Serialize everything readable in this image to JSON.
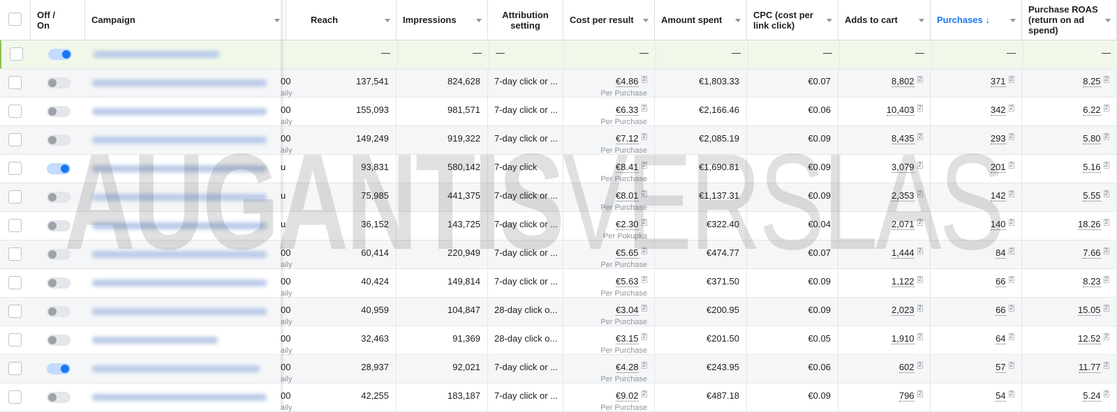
{
  "columns": {
    "off_on": "Off / On",
    "campaign": "Campaign",
    "reach": "Reach",
    "impressions": "Impressions",
    "attribution": "Attribution setting",
    "cost_per_result": "Cost per result",
    "amount_spent": "Amount spent",
    "cpc": "CPC (cost per link click)",
    "adds_to_cart": "Adds to cart",
    "purchases": "Purchases ↓",
    "roas": "Purchase ROAS (return on ad spend)"
  },
  "total_row": {
    "reach": "—",
    "impressions": "—",
    "attribution": "—",
    "cost_per_result": "—",
    "amount_spent": "—",
    "cpc": "—",
    "adds_to_cart": "—",
    "purchases": "—",
    "roas": "—"
  },
  "rows": [
    {
      "on": false,
      "budget": "00",
      "budget_sub": "aily",
      "reach": "137,541",
      "impressions": "824,628",
      "attribution": "7-day click or ...",
      "cost_per_result": "€4.86",
      "result_label": "Per Purchase",
      "amount_spent": "€1,803.33",
      "cpc": "€0.07",
      "adds_to_cart": "8,802",
      "purchases": "371",
      "roas": "8.25"
    },
    {
      "on": false,
      "budget": "00",
      "budget_sub": "aily",
      "reach": "155,093",
      "impressions": "981,571",
      "attribution": "7-day click or ...",
      "cost_per_result": "€6.33",
      "result_label": "Per Purchase",
      "amount_spent": "€2,166.46",
      "cpc": "€0.06",
      "adds_to_cart": "10,403",
      "purchases": "342",
      "roas": "6.22"
    },
    {
      "on": false,
      "budget": "00",
      "budget_sub": "aily",
      "reach": "149,249",
      "impressions": "919,322",
      "attribution": "7-day click or ...",
      "cost_per_result": "€7.12",
      "result_label": "Per Purchase",
      "amount_spent": "€2,085.19",
      "cpc": "€0.09",
      "adds_to_cart": "8,435",
      "purchases": "293",
      "roas": "5.80"
    },
    {
      "on": true,
      "budget": "u",
      "budget_sub": "",
      "reach": "93,831",
      "impressions": "580,142",
      "attribution": "7-day click",
      "cost_per_result": "€8.41",
      "result_label": "Per Purchase",
      "amount_spent": "€1,690.81",
      "cpc": "€0.09",
      "adds_to_cart": "3,079",
      "purchases": "201",
      "roas": "5.16"
    },
    {
      "on": false,
      "budget": "u",
      "budget_sub": "",
      "reach": "75,985",
      "impressions": "441,375",
      "attribution": "7-day click or ...",
      "cost_per_result": "€8.01",
      "result_label": "Per Purchase",
      "amount_spent": "€1,137.31",
      "cpc": "€0.09",
      "adds_to_cart": "2,353",
      "purchases": "142",
      "roas": "5.55"
    },
    {
      "on": false,
      "budget": "u",
      "budget_sub": "",
      "reach": "36,152",
      "impressions": "143,725",
      "attribution": "7-day click or ...",
      "cost_per_result": "€2.30",
      "result_label": "Per Pokupka",
      "amount_spent": "€322.40",
      "cpc": "€0.04",
      "adds_to_cart": "2,071",
      "purchases": "140",
      "roas": "18.26"
    },
    {
      "on": false,
      "budget": "00",
      "budget_sub": "aily",
      "reach": "60,414",
      "impressions": "220,949",
      "attribution": "7-day click or ...",
      "cost_per_result": "€5.65",
      "result_label": "Per Purchase",
      "amount_spent": "€474.77",
      "cpc": "€0.07",
      "adds_to_cart": "1,444",
      "purchases": "84",
      "roas": "7.66"
    },
    {
      "on": false,
      "budget": "00",
      "budget_sub": "aily",
      "reach": "40,424",
      "impressions": "149,814",
      "attribution": "7-day click or ...",
      "cost_per_result": "€5.63",
      "result_label": "Per Purchase",
      "amount_spent": "€371.50",
      "cpc": "€0.09",
      "adds_to_cart": "1,122",
      "purchases": "66",
      "roas": "8.23"
    },
    {
      "on": false,
      "budget": "00",
      "budget_sub": "aily",
      "reach": "40,959",
      "impressions": "104,847",
      "attribution": "28-day click o...",
      "cost_per_result": "€3.04",
      "result_label": "Per Purchase",
      "amount_spent": "€200.95",
      "cpc": "€0.09",
      "adds_to_cart": "2,023",
      "purchases": "66",
      "roas": "15.05"
    },
    {
      "on": false,
      "budget": "00",
      "budget_sub": "aily",
      "reach": "32,463",
      "impressions": "91,369",
      "attribution": "28-day click o...",
      "cost_per_result": "€3.15",
      "result_label": "Per Purchase",
      "amount_spent": "€201.50",
      "cpc": "€0.05",
      "adds_to_cart": "1,910",
      "purchases": "64",
      "roas": "12.52"
    },
    {
      "on": true,
      "budget": "00",
      "budget_sub": "aily",
      "reach": "28,937",
      "impressions": "92,021",
      "attribution": "7-day click or ...",
      "cost_per_result": "€4.28",
      "result_label": "Per Purchase",
      "amount_spent": "€243.95",
      "cpc": "€0.06",
      "adds_to_cart": "602",
      "purchases": "57",
      "roas": "11.77"
    },
    {
      "on": false,
      "budget": "00",
      "budget_sub": "aily",
      "reach": "42,255",
      "impressions": "183,187",
      "attribution": "7-day click or ...",
      "cost_per_result": "€9.02",
      "result_label": "Per Purchase",
      "amount_spent": "€487.18",
      "cpc": "€0.09",
      "adds_to_cart": "796",
      "purchases": "54",
      "roas": "5.24"
    }
  ],
  "watermark": {
    "bold": "AUGANTIS",
    "light": "VERSLAS"
  },
  "colors": {
    "accent": "#1877f2",
    "total_row_bg": "#f1f8ea",
    "total_row_border": "#8bc34a"
  }
}
